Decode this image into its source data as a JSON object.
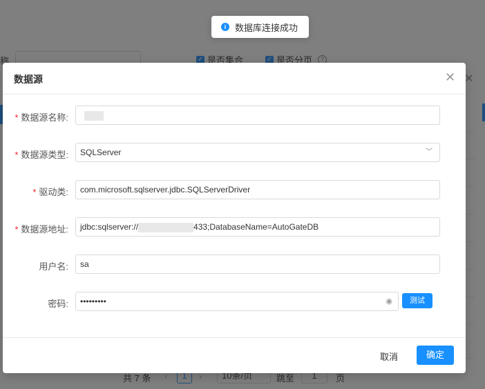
{
  "toast": {
    "text": "数据库连接成功",
    "icon": "info-icon"
  },
  "background": {
    "partial_label": "称",
    "check1": "是否集合",
    "check2": "是否分页",
    "pager": {
      "total": "共 7 条",
      "page": "1",
      "page_size": "10条/页",
      "goto": "跳至",
      "goto_value": "1",
      "page_unit": "页"
    }
  },
  "dialog": {
    "title": "数据源",
    "fields": {
      "name": {
        "label": "数据源名称:",
        "required": true,
        "value": ""
      },
      "type": {
        "label": "数据源类型:",
        "required": true,
        "value": "SQLServer"
      },
      "driver": {
        "label": "驱动类:",
        "required": true,
        "value": "com.microsoft.sqlserver.jdbc.SQLServerDriver"
      },
      "url": {
        "label": "数据源地址:",
        "required": true,
        "value_prefix": "jdbc:sqlserver://",
        "value_suffix": "433;DatabaseName=AutoGateDB"
      },
      "username": {
        "label": "用户名:",
        "required": false,
        "value": "sa"
      },
      "password": {
        "label": "密码:",
        "required": false,
        "value": "•••••••••"
      }
    },
    "test_button": "测试",
    "cancel_button": "取消",
    "ok_button": "确定"
  },
  "colors": {
    "primary": "#1890ff",
    "required": "#f5222d",
    "mask": "rgba(0,0,0,0.5)"
  }
}
